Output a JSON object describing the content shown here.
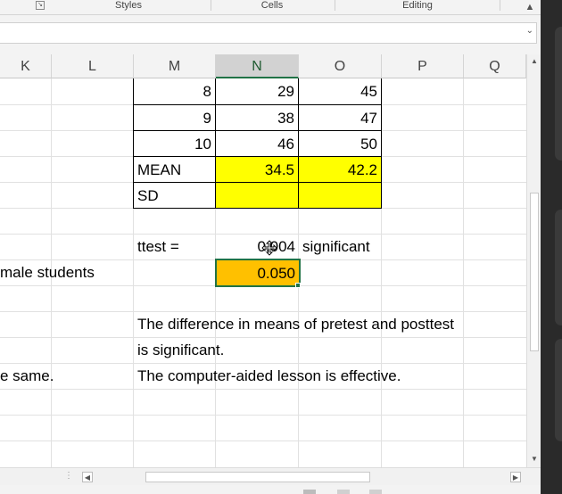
{
  "ribbon": {
    "groups": [
      "Styles",
      "Cells",
      "Editing"
    ],
    "launcher_icon": "dialog-launcher-icon",
    "collapse_icon": "chevron-up-icon"
  },
  "formula_bar": {
    "value": "",
    "expand_icon": "chevron-down-icon"
  },
  "columns": [
    "K",
    "L",
    "M",
    "N",
    "O",
    "P",
    "Q"
  ],
  "active_column": "N",
  "cells": {
    "m1": "8",
    "n1": "29",
    "o1": "45",
    "m2": "9",
    "n2": "38",
    "o2": "47",
    "m3": "10",
    "n3": "46",
    "o3": "50",
    "mean_label": "MEAN",
    "mean_n": "34.5",
    "mean_o": "42.2",
    "sd_label": "SD",
    "ttest_label": "ttest =",
    "ttest_value": "0.004",
    "ttest_result": "significant",
    "k_row8": "male students",
    "alpha": "0.050",
    "conclusion_1": "The difference in means of pretest and posttest",
    "conclusion_2": "is significant.",
    "conclusion_3": "The computer-aided lesson is effective.",
    "k_row12": "e same."
  },
  "colors": {
    "highlight_yellow": "#ffff00",
    "highlight_orange": "#ffc000",
    "selection_green": "#217346"
  },
  "scroll_icons": [
    "up-arrow-icon",
    "down-arrow-icon",
    "left-arrow-icon",
    "right-arrow-icon"
  ]
}
